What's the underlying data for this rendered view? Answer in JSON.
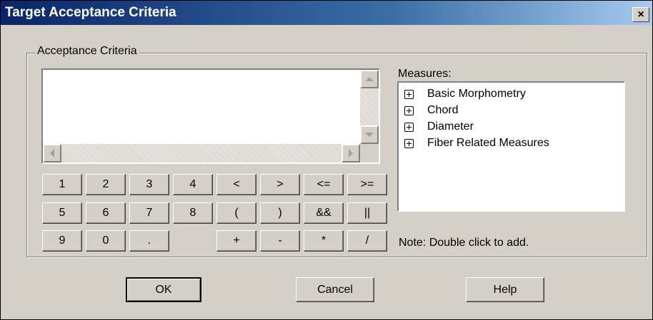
{
  "window": {
    "title": "Target Acceptance Criteria",
    "close_label": "×"
  },
  "group": {
    "legend": "Acceptance Criteria"
  },
  "criteria_input": {
    "value": ""
  },
  "keypad": [
    {
      "label": "1"
    },
    {
      "label": "2"
    },
    {
      "label": "3"
    },
    {
      "label": "4"
    },
    {
      "label": "<"
    },
    {
      "label": ">"
    },
    {
      "label": "<="
    },
    {
      "label": ">="
    },
    {
      "label": "5"
    },
    {
      "label": "6"
    },
    {
      "label": "7"
    },
    {
      "label": "8"
    },
    {
      "label": "("
    },
    {
      "label": ")"
    },
    {
      "label": "&&"
    },
    {
      "label": "||"
    },
    {
      "label": "9"
    },
    {
      "label": "0"
    },
    {
      "label": "."
    },
    {
      "label": "+"
    },
    {
      "label": "-"
    },
    {
      "label": "*"
    },
    {
      "label": "/"
    }
  ],
  "measures": {
    "label": "Measures:",
    "items": [
      {
        "label": "Basic Morphometry"
      },
      {
        "label": "Chord"
      },
      {
        "label": "Diameter"
      },
      {
        "label": "Fiber Related Measures"
      }
    ],
    "note": "Note:  Double click to add."
  },
  "buttons": {
    "ok": "OK",
    "cancel": "Cancel",
    "help": "Help"
  }
}
